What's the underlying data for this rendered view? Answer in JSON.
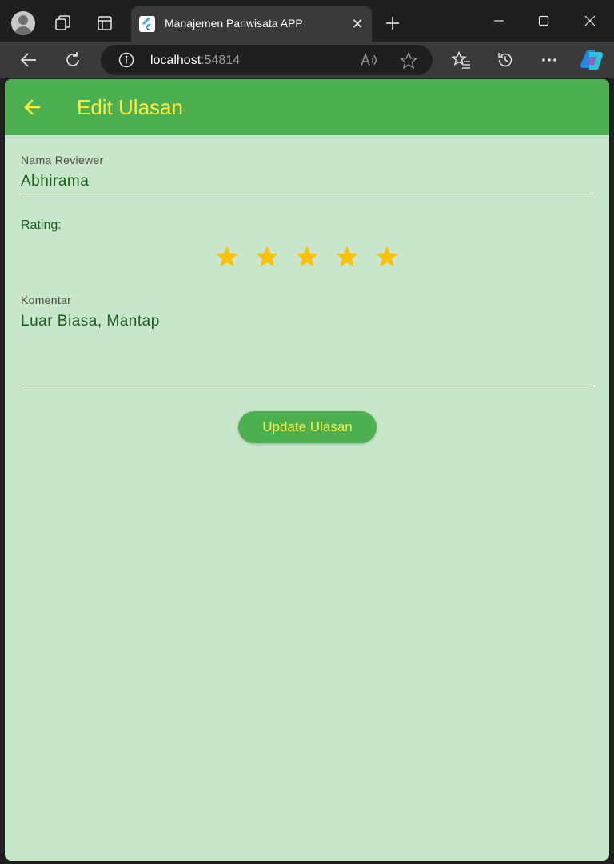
{
  "browser": {
    "tab_title": "Manajemen Pariwisata APP",
    "url_host": "localhost",
    "url_port": ":54814"
  },
  "appbar": {
    "title": "Edit Ulasan"
  },
  "form": {
    "reviewer_label": "Nama Reviewer",
    "reviewer_value": "Abhirama",
    "rating_label": "Rating:",
    "rating": {
      "value": 5,
      "max": 5
    },
    "comment_label": "Komentar",
    "comment_value": "Luar Biasa, Mantap",
    "submit_label": "Update Ulasan"
  },
  "colors": {
    "appbar": "#4caf50",
    "accent_text": "#ffeb3b",
    "page_background": "#c8e6c9",
    "star": "#ffc107",
    "field_text": "#1b5e20"
  }
}
